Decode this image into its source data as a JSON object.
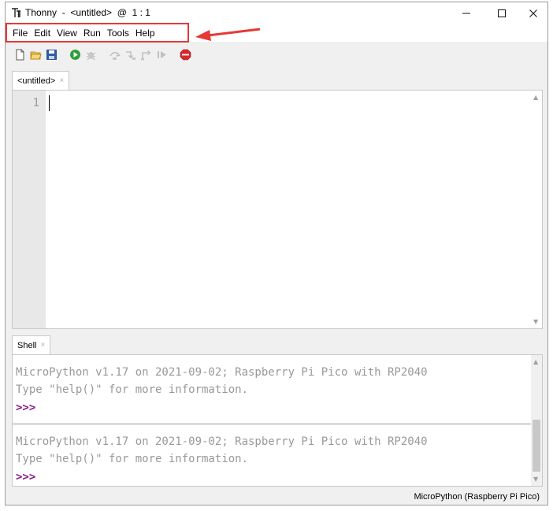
{
  "window": {
    "title": "Thonny  -  <untitled>  @  1 : 1",
    "app_icon": "thonny-logo-icon",
    "controls": [
      "minimize-icon",
      "maximize-icon",
      "close-icon"
    ]
  },
  "menu": {
    "items": [
      {
        "label": "File"
      },
      {
        "label": "Edit"
      },
      {
        "label": "View"
      },
      {
        "label": "Run"
      },
      {
        "label": "Tools"
      },
      {
        "label": "Help"
      }
    ],
    "highlight_color": "#e53935"
  },
  "toolbar": {
    "icons": [
      "new-file-icon",
      "open-folder-icon",
      "save-icon",
      "run-icon",
      "debug-icon",
      "step-over-icon",
      "step-into-icon",
      "step-out-icon",
      "resume-icon",
      "stop-icon"
    ]
  },
  "editor": {
    "tab_label": "<untitled>",
    "tab_close": "×",
    "line_numbers": [
      "1"
    ]
  },
  "shell": {
    "tab_label": "Shell",
    "tab_close": "×",
    "session1": {
      "line1": "MicroPython v1.17 on 2021-09-02; Raspberry Pi Pico with RP2040",
      "line2": "Type \"help()\" for more information.",
      "prompt": ">>>"
    },
    "session2": {
      "line1": "MicroPython v1.17 on 2021-09-02; Raspberry Pi Pico with RP2040",
      "line2": "Type \"help()\" for more information.",
      "prompt": ">>>"
    }
  },
  "status": {
    "interpreter": "MicroPython (Raspberry Pi Pico)"
  },
  "colors": {
    "prompt": "#8a1a8a",
    "output_text": "#999999",
    "annotation": "#e53935"
  }
}
